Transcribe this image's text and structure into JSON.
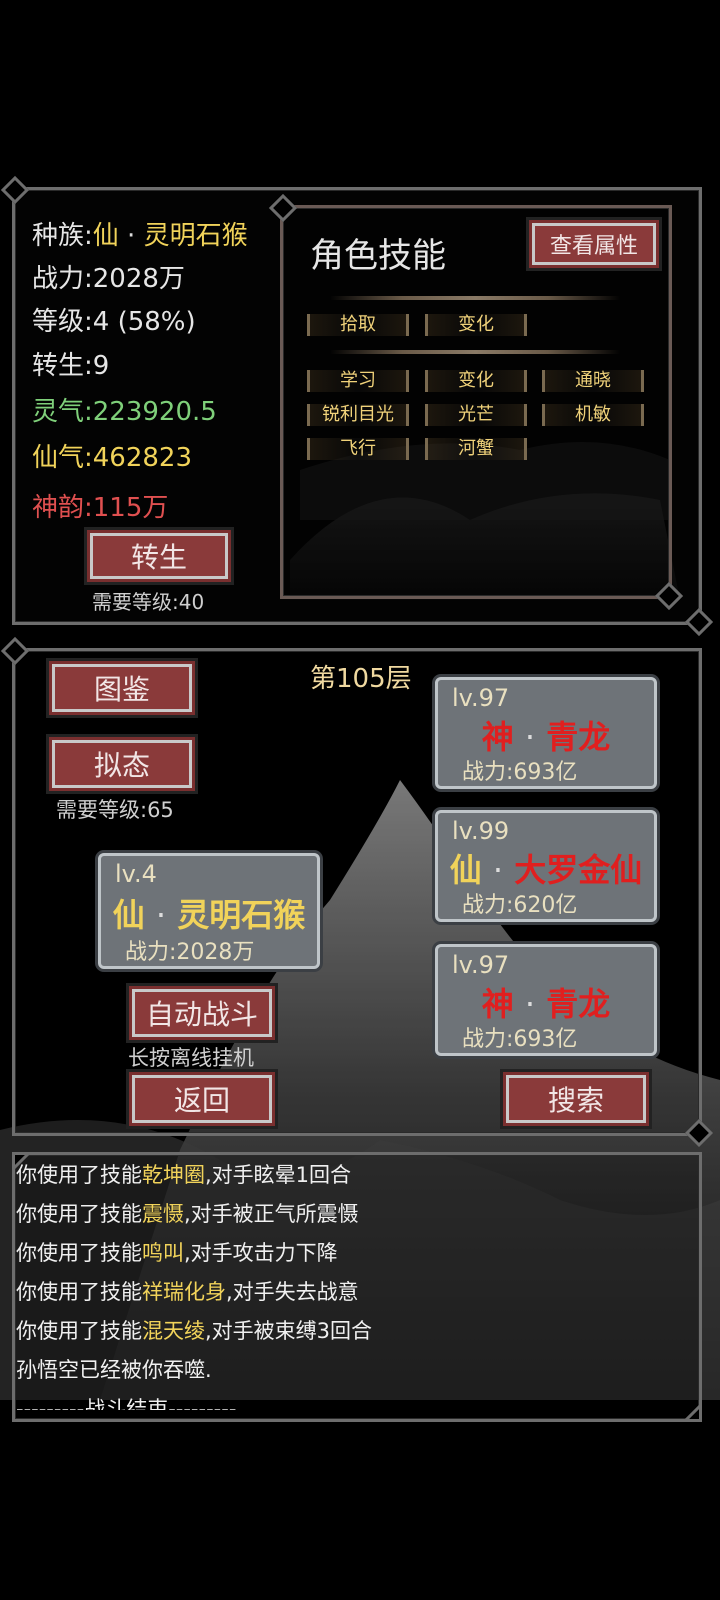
{
  "stats": {
    "race_label": "种族:",
    "race_prefix": "仙",
    "race_sep": "·",
    "race_name": "灵明石猴",
    "power": "战力:2028万",
    "level": "等级:4 (58%)",
    "rebirth": "转生:9",
    "lingqi": "灵气:223920.5",
    "xianqi": "仙气:462823",
    "shenyun": "神韵:115万"
  },
  "rebirth_button": {
    "label": "转生",
    "requirement": "需要等级:40"
  },
  "skills_panel": {
    "title": "角色技能",
    "view_attr_label": "查看属性",
    "row1": [
      "拾取",
      "变化"
    ],
    "row2": [
      "学习",
      "变化",
      "通晓",
      "锐利目光",
      "光芒",
      "机敏",
      "飞行",
      "河蟹"
    ]
  },
  "battle": {
    "floor": "第105层",
    "atlas_label": "图鉴",
    "mimic_label": "拟态",
    "mimic_requirement": "需要等级:65",
    "auto_label": "自动战斗",
    "auto_hint": "长按离线挂机",
    "back_label": "返回",
    "search_label": "搜索",
    "player": {
      "lv": "lv.4",
      "prefix": "仙",
      "sep": "·",
      "name": "灵明石猴",
      "power": "战力:2028万"
    },
    "enemies": [
      {
        "lv": "lv.97",
        "prefix": "神",
        "sep": "·",
        "name": "青龙",
        "power": "战力:693亿"
      },
      {
        "lv": "lv.99",
        "prefix": "仙",
        "sep": "·",
        "name": "大罗金仙",
        "power": "战力:620亿"
      },
      {
        "lv": "lv.97",
        "prefix": "神",
        "sep": "·",
        "name": "青龙",
        "power": "战力:693亿"
      }
    ]
  },
  "log": [
    {
      "pre": "你使用了技能",
      "skill": "乾坤圈",
      "post": ",对手眩晕1回合"
    },
    {
      "pre": "你使用了技能",
      "skill": "震慑",
      "post": ",对手被正气所震慑"
    },
    {
      "pre": "你使用了技能",
      "skill": "鸣叫",
      "post": ",对手攻击力下降"
    },
    {
      "pre": "你使用了技能",
      "skill": "祥瑞化身",
      "post": ",对手失去战意"
    },
    {
      "pre": "你使用了技能",
      "skill": "混天绫",
      "post": ",对手被束缚3回合"
    },
    {
      "pre": "孙悟空已经被你吞噬.",
      "skill": "",
      "post": ""
    },
    {
      "pre": "---------战斗结束---------",
      "skill": "",
      "post": ""
    }
  ],
  "colors": {
    "gold": "#f1d35a",
    "green": "#7fd07a",
    "red_text": "#e05050",
    "enemy_red": "#e01f1f",
    "button_red": "#8a3a3a"
  }
}
